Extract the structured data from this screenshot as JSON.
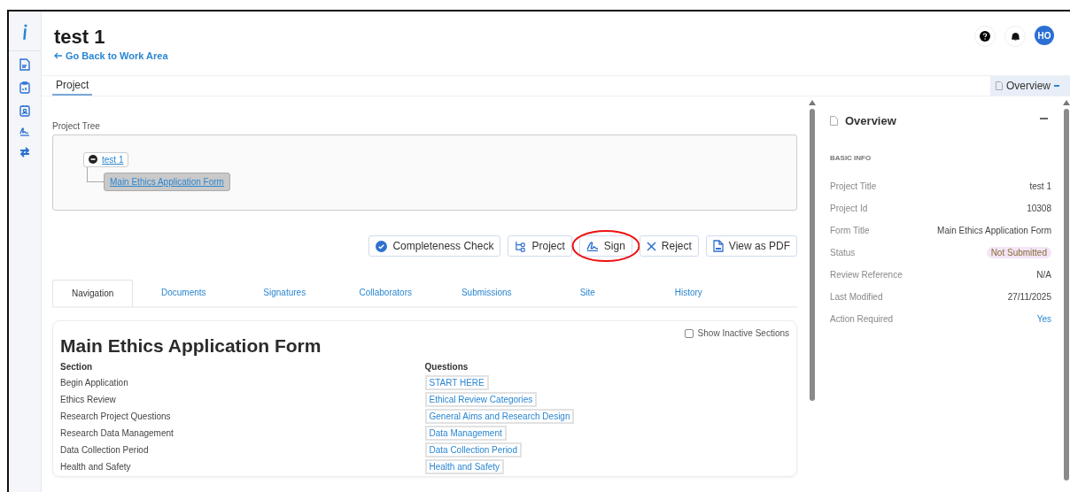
{
  "header": {
    "title": "test 1",
    "back_link": "Go Back to Work Area",
    "avatar": "HO"
  },
  "tabs": [
    {
      "label": "Project",
      "selected": true
    }
  ],
  "panel_toggle": {
    "label": "Overview",
    "expanded": true
  },
  "project_tree": {
    "label": "Project Tree",
    "root": {
      "label": "test 1",
      "expanded": true,
      "children": [
        {
          "label": "Main Ethics Application Form",
          "selected": true
        }
      ]
    }
  },
  "actions": [
    {
      "label": "Completeness Check",
      "kind": "check",
      "circled": false
    },
    {
      "label": "Project",
      "kind": "tree",
      "circled": false
    },
    {
      "label": "Sign",
      "kind": "sign",
      "circled": true
    },
    {
      "label": "Reject",
      "kind": "reject",
      "circled": false
    },
    {
      "label": "View as PDF",
      "kind": "pdf",
      "circled": false
    }
  ],
  "section_tabs": [
    {
      "label": "Navigation",
      "selected": true
    },
    {
      "label": "Documents",
      "selected": false
    },
    {
      "label": "Signatures",
      "selected": false
    },
    {
      "label": "Collaborators",
      "selected": false
    },
    {
      "label": "Submissions",
      "selected": false
    },
    {
      "label": "Site",
      "selected": false
    },
    {
      "label": "History",
      "selected": false
    }
  ],
  "form": {
    "title": "Main Ethics Application Form",
    "show_inactive": {
      "label": "Show Inactive Sections",
      "checked": false
    },
    "columns": [
      "Section",
      "Questions"
    ],
    "rows": [
      {
        "section": "Begin Application",
        "question": "START HERE"
      },
      {
        "section": "Ethics Review",
        "question": "Ethical Review Categories"
      },
      {
        "section": "Research Project Questions",
        "question": "General Aims and Research Design"
      },
      {
        "section": "Research Data Management",
        "question": "Data Management"
      },
      {
        "section": "Data Collection Period",
        "question": "Data Collection Period"
      },
      {
        "section": "Health and Safety",
        "question": "Health and Safety"
      }
    ]
  },
  "overview": {
    "title": "Overview",
    "heading": "BASIC INFO",
    "fields": [
      {
        "label": "Project Title",
        "value": "test 1",
        "kind": "text"
      },
      {
        "label": "Project Id",
        "value": "10308",
        "kind": "text"
      },
      {
        "label": "Form Title",
        "value": "Main Ethics Application Form",
        "kind": "text"
      },
      {
        "label": "Status",
        "value": "Not Submitted",
        "kind": "badge"
      },
      {
        "label": "Review Reference",
        "value": "N/A",
        "kind": "text"
      },
      {
        "label": "Last Modified",
        "value": "27/11/2025",
        "kind": "text"
      },
      {
        "label": "Action Required",
        "value": "Yes",
        "kind": "link"
      }
    ]
  }
}
